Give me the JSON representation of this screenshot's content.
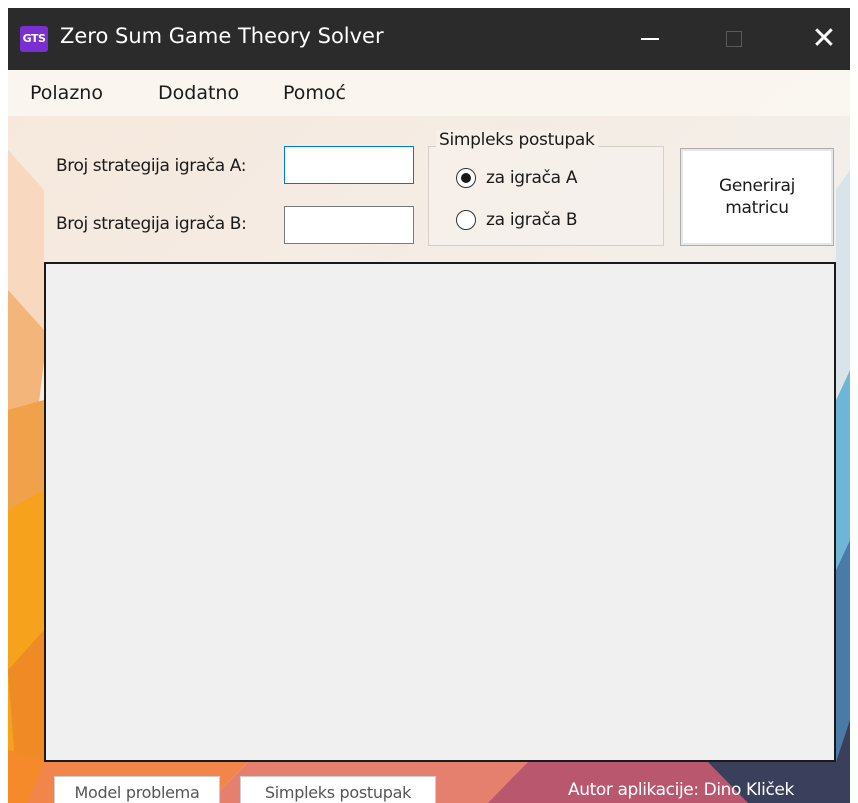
{
  "window": {
    "app_icon_text": "GTS",
    "title": "Zero Sum Game Theory Solver",
    "controls": [
      "minimize",
      "maximize",
      "close"
    ],
    "close_glyph": "✕"
  },
  "menu": {
    "items": [
      {
        "label": "Polazno"
      },
      {
        "label": "Dodatno"
      },
      {
        "label": "Pomoć"
      }
    ]
  },
  "form": {
    "strategies_a_label": "Broj strategija igrača A:",
    "strategies_a_value": "",
    "strategies_b_label": "Broj strategija igrača B:",
    "strategies_b_value": "",
    "simplex_group_title": "Simpleks postupak",
    "radio_a_label": "za igrača A",
    "radio_b_label": "za igrača B",
    "selected_radio": "za igrača A",
    "generate_button_label": "Generiraj matricu"
  },
  "footer": {
    "model_button_label": "Model problema",
    "simplex_button_label": "Simpleks postupak",
    "author_text": "Autor aplikacije: Dino Kliček"
  },
  "colors": {
    "titlebar": "#2b2b2b",
    "app_icon": "#7b2fd0",
    "focus_border": "#0078d7",
    "panel": "#f0f0f0"
  }
}
